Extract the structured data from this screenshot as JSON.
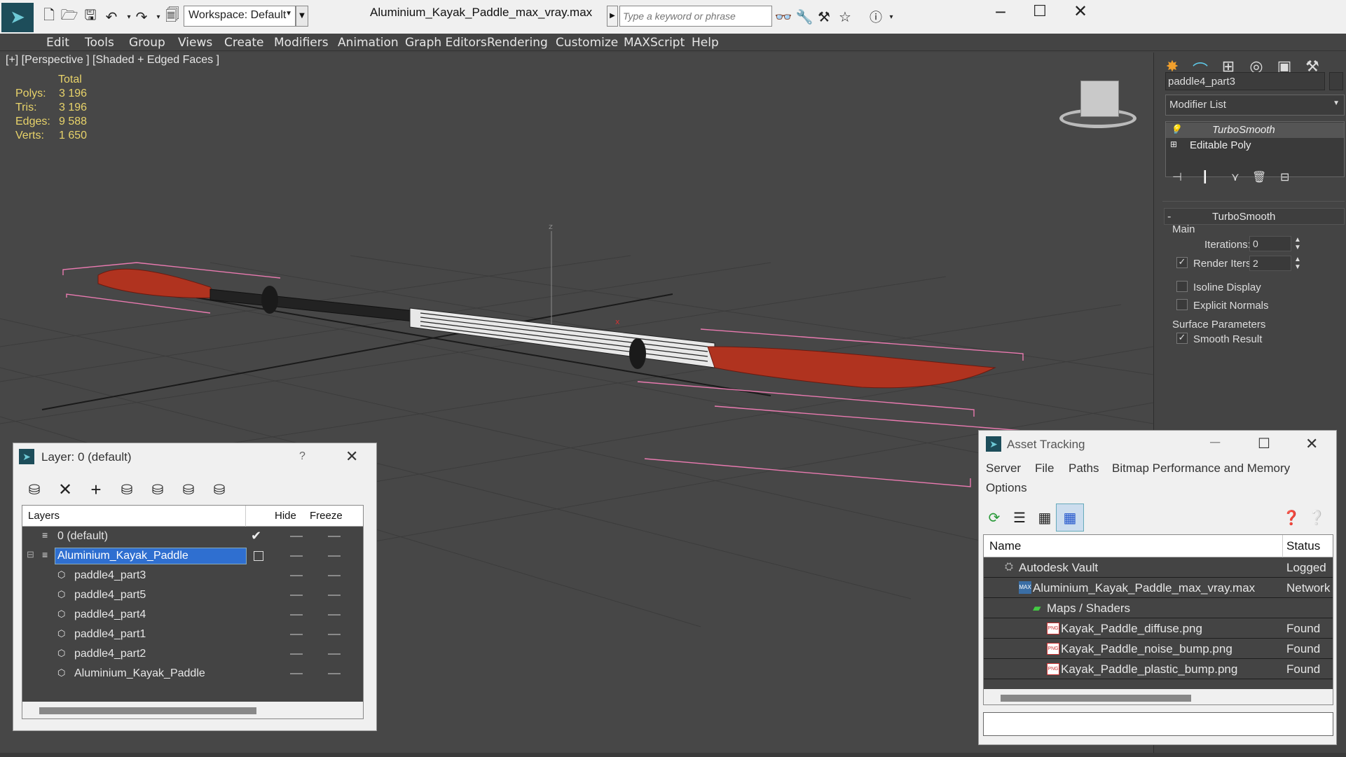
{
  "window": {
    "title": "Aluminium_Kayak_Paddle_max_vray.max",
    "workspace_label": "Workspace: Default",
    "search_placeholder": "Type a keyword or phrase"
  },
  "menu": [
    "Edit",
    "Tools",
    "Group",
    "Views",
    "Create",
    "Modifiers",
    "Animation",
    "Graph Editors",
    "Rendering",
    "Customize",
    "MAXScript",
    "Help"
  ],
  "viewport": {
    "label": "[+] [Perspective ] [Shaded + Edged Faces ]",
    "stats": {
      "header": "Total",
      "rows": [
        {
          "label": "Polys:",
          "value": "3 196"
        },
        {
          "label": "Tris:",
          "value": "3 196"
        },
        {
          "label": "Edges:",
          "value": "9 588"
        },
        {
          "label": "Verts:",
          "value": "1 650"
        }
      ]
    },
    "axis_z": "z",
    "axis_x": "x"
  },
  "command_panel": {
    "object_name": "paddle4_part3",
    "modifier_list_label": "Modifier List",
    "stack": [
      "TurboSmooth",
      "Editable Poly"
    ],
    "rollout_title": "TurboSmooth",
    "main_group": "Main",
    "iterations_label": "Iterations:",
    "iterations_value": "0",
    "render_iters_label": "Render Iters:",
    "render_iters_value": "2",
    "isoline_label": "Isoline Display",
    "explicit_normals_label": "Explicit Normals",
    "surface_group": "Surface Parameters",
    "smooth_result_label": "Smooth Result"
  },
  "layer_dialog": {
    "title": "Layer: 0 (default)",
    "help": "?",
    "col_layers": "Layers",
    "col_hide": "Hide",
    "col_freeze": "Freeze",
    "rows": [
      {
        "name": "0 (default)",
        "level": 0,
        "current": true
      },
      {
        "name": "Aluminium_Kayak_Paddle",
        "level": 0,
        "selected": true
      },
      {
        "name": "paddle4_part3",
        "level": 1
      },
      {
        "name": "paddle4_part5",
        "level": 1
      },
      {
        "name": "paddle4_part4",
        "level": 1
      },
      {
        "name": "paddle4_part1",
        "level": 1
      },
      {
        "name": "paddle4_part2",
        "level": 1
      },
      {
        "name": "Aluminium_Kayak_Paddle",
        "level": 1
      }
    ]
  },
  "asset_tracking": {
    "title": "Asset Tracking",
    "menu": [
      "Server",
      "File",
      "Paths",
      "Bitmap Performance and Memory",
      "Options"
    ],
    "col_name": "Name",
    "col_status": "Status",
    "rows": [
      {
        "name": "Autodesk Vault",
        "status": "Logged",
        "icon": "vault-icon",
        "level": 0
      },
      {
        "name": "Aluminium_Kayak_Paddle_max_vray.max",
        "status": "Network",
        "icon": "max-file-icon",
        "level": 1
      },
      {
        "name": "Maps / Shaders",
        "status": "",
        "icon": "maps-icon",
        "level": 2
      },
      {
        "name": "Kayak_Paddle_diffuse.png",
        "status": "Found",
        "icon": "png-icon",
        "level": 3
      },
      {
        "name": "Kayak_Paddle_noise_bump.png",
        "status": "Found",
        "icon": "png-icon",
        "level": 3
      },
      {
        "name": "Kayak_Paddle_plastic_bump.png",
        "status": "Found",
        "icon": "png-icon",
        "level": 3
      }
    ]
  }
}
